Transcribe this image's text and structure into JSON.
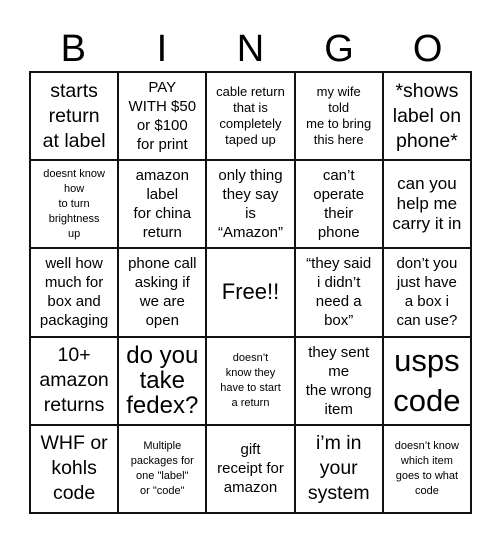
{
  "header": {
    "letters": [
      "B",
      "I",
      "N",
      "G",
      "O"
    ]
  },
  "cells": [
    {
      "text": "starts\nreturn\nat label",
      "size": "s20"
    },
    {
      "text": "PAY\nWITH $50\nor $100\nfor print",
      "size": "s15"
    },
    {
      "text": "cable return\nthat is\ncompletely\ntaped up",
      "size": "s13"
    },
    {
      "text": "my wife\ntold\nme to bring\nthis here",
      "size": "s13"
    },
    {
      "text": "*shows\nlabel on\nphone*",
      "size": "s20"
    },
    {
      "text": "doesnt know\nhow\nto turn\nbrightness\nup",
      "size": "s11"
    },
    {
      "text": "amazon\nlabel\nfor china\nreturn",
      "size": "s15"
    },
    {
      "text": "only thing\nthey say\nis\n“Amazon”",
      "size": "s15"
    },
    {
      "text": "can’t\noperate\ntheir\nphone",
      "size": "s15"
    },
    {
      "text": "can you\nhelp me\ncarry it in",
      "size": "s17"
    },
    {
      "text": "well how\nmuch for\nbox and\npackaging",
      "size": "s15"
    },
    {
      "text": "phone call\nasking if\nwe are\nopen",
      "size": "s15"
    },
    {
      "text": "Free!!",
      "size": "s22"
    },
    {
      "text": "“they said\ni didn’t\nneed a\nbox”",
      "size": "s15"
    },
    {
      "text": "don’t you\njust have\na box i\ncan use?",
      "size": "s15"
    },
    {
      "text": "10+\namazon\nreturns",
      "size": "s20"
    },
    {
      "text": "do you\ntake\nfedex?",
      "size": "s25"
    },
    {
      "text": "doesn’t\nknow they\nhave to start\na return",
      "size": "s11"
    },
    {
      "text": "they sent\nme\nthe wrong\nitem",
      "size": "s15"
    },
    {
      "text": "usps\ncode",
      "size": "s30"
    },
    {
      "text": "WHF or\nkohls\ncode",
      "size": "s20"
    },
    {
      "text": "Multiple\npackages for\none \"label\"\nor \"code\"",
      "size": "s11"
    },
    {
      "text": "gift\nreceipt for\namazon",
      "size": "s15"
    },
    {
      "text": "i’m in\nyour\nsystem",
      "size": "s20"
    },
    {
      "text": "doesn’t know\nwhich item\ngoes to what\ncode",
      "size": "s11"
    }
  ]
}
